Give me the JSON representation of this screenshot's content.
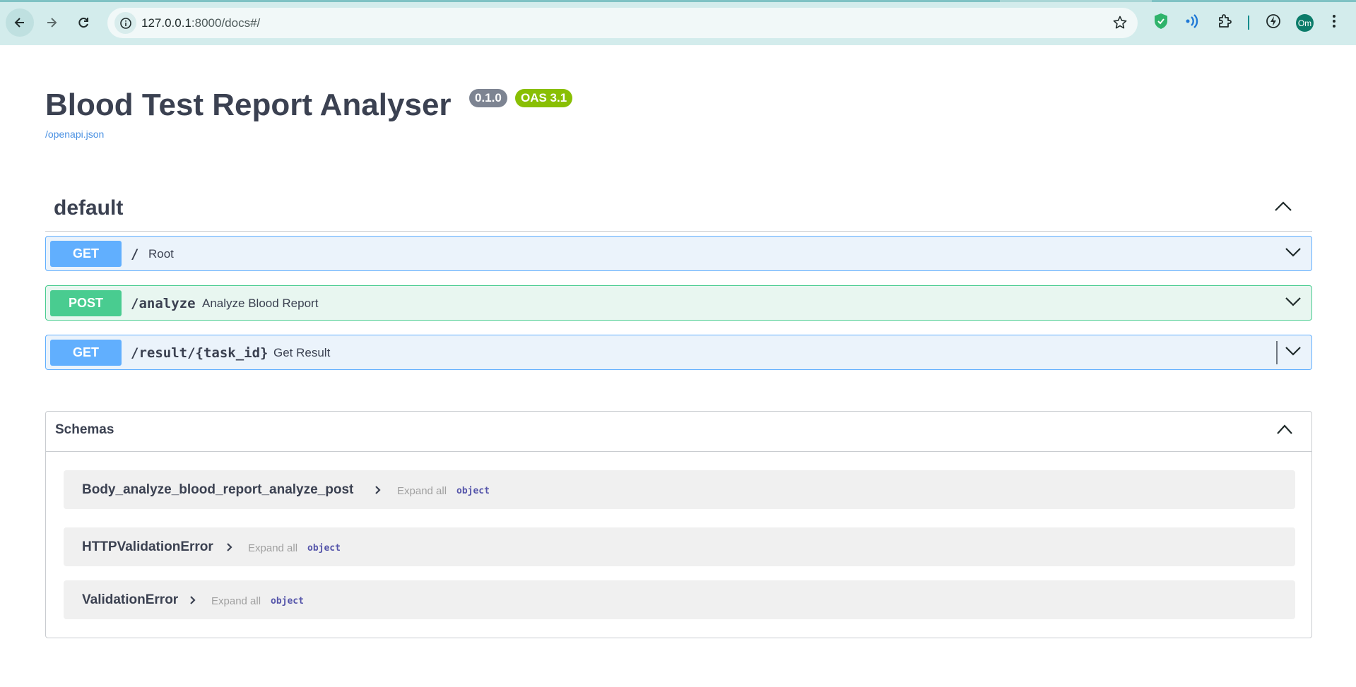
{
  "browser": {
    "url_host": "127.0.0.1",
    "url_rest": ":8000/docs#/",
    "profile_initials": "Om"
  },
  "info": {
    "title": "Blood Test Report Analyser",
    "version": "0.1.0",
    "oas_version": "OAS 3.1",
    "spec_link": "/openapi.json"
  },
  "tag": {
    "name": "default"
  },
  "operations": [
    {
      "method": "GET",
      "path": "/",
      "summary": "Root"
    },
    {
      "method": "POST",
      "path": "/analyze",
      "summary": "Analyze Blood Report"
    },
    {
      "method": "GET",
      "path": "/result/{task_id}",
      "summary": "Get Result"
    }
  ],
  "schemas": {
    "title": "Schemas",
    "models": [
      {
        "name": "Body_analyze_blood_report_analyze_post",
        "expand_label": "Expand all",
        "type": "object"
      },
      {
        "name": "HTTPValidationError",
        "expand_label": "Expand all",
        "type": "object"
      },
      {
        "name": "ValidationError",
        "expand_label": "Expand all",
        "type": "object"
      }
    ]
  },
  "colors": {
    "get": "#61affe",
    "post": "#49cc90",
    "version_badge": "#7d8492",
    "oas_badge": "#89bf04",
    "link": "#4990e2"
  }
}
